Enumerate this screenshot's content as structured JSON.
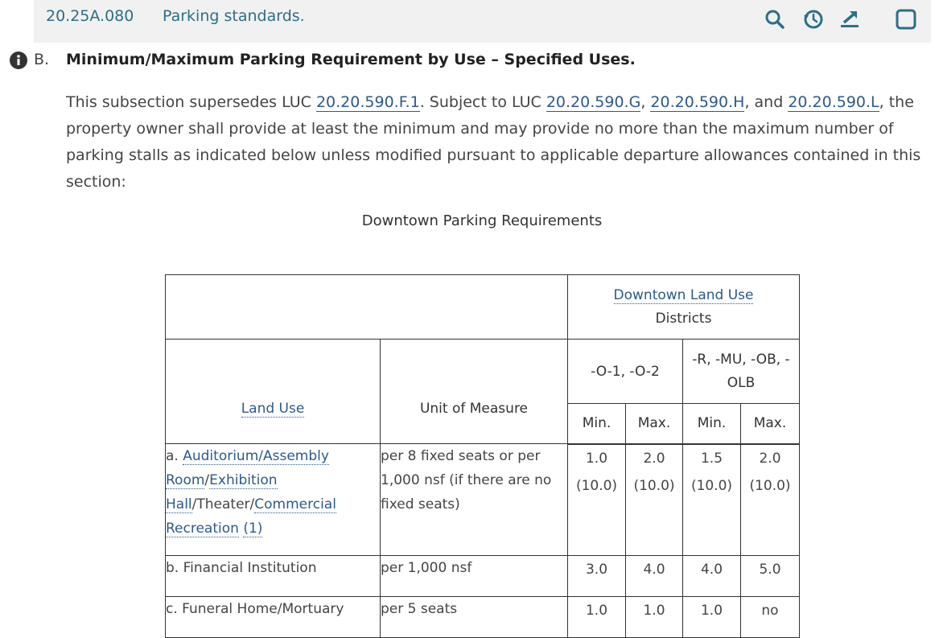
{
  "header": {
    "section_number": "20.25A.080",
    "section_title": "Parking standards.",
    "tools": [
      "search-icon",
      "history-icon",
      "download-icon",
      "checkbox-icon"
    ]
  },
  "subsection": {
    "letter": "B.",
    "heading": "Minimum/Maximum Parking Requirement by Use – Specified Uses."
  },
  "paragraph": {
    "t1": "This subsection supersedes LUC ",
    "link1": "20.20.590.F.1",
    "t2": ". Subject to LUC ",
    "link2": "20.20.590.G",
    "t3": ", ",
    "link3": "20.20.590.H",
    "t4": ", and ",
    "link4": "20.20.590.L",
    "t5": ", the property owner shall provide at least the minimum and may provide no more than the maximum number of parking stalls as indicated below unless modified pursuant to applicable departure allowances contained in this section:"
  },
  "table": {
    "caption": "Downtown Parking Requirements",
    "header": {
      "districts_link": "Downtown Land Use",
      "districts_rest": "Districts",
      "land_use": "Land Use",
      "unit": "Unit of Measure",
      "group1": "-O-1, -O-2",
      "group2": "-R, -MU, -OB, -OLB",
      "min": "Min.",
      "max": "Max."
    },
    "rows": [
      {
        "prefix": "a. ",
        "link1": "Auditorium/Assembly Room",
        "sep1": "/",
        "link2": "Exhibition Hall",
        "sep2": "/Theater/",
        "link3": "Commercial Recreation",
        "sep3": " ",
        "link4": "(1)",
        "unit": "per 8 fixed seats or per 1,000 nsf (if there are no fixed seats)",
        "v1": "1.0",
        "v1b": "(10.0)",
        "v2": "2.0",
        "v2b": "(10.0)",
        "v3": "1.5",
        "v3b": "(10.0)",
        "v4": "2.0",
        "v4b": "(10.0)"
      },
      {
        "use": "b. Financial Institution",
        "unit": "per 1,000 nsf",
        "v1": "3.0",
        "v2": "4.0",
        "v3": "4.0",
        "v4": "5.0"
      },
      {
        "use": "c. Funeral Home/Mortuary",
        "unit": "per 5 seats",
        "v1": "1.0",
        "v2": "1.0",
        "v3": "1.0",
        "v4": "no"
      }
    ]
  }
}
